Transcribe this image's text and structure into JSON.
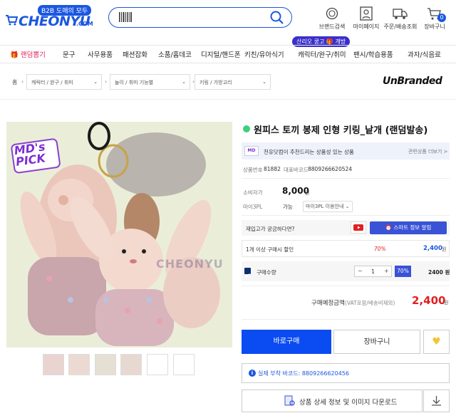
{
  "header": {
    "logo_badge": "B2B 도매의 모두",
    "logo_text": "CHEONYU",
    "logo_com": ".COM",
    "icons": [
      {
        "label": "브랜드검색",
        "icon": "medal-icon"
      },
      {
        "label": "마이페이지",
        "icon": "person-icon"
      },
      {
        "label": "주문/배송조회",
        "icon": "truck-icon"
      },
      {
        "label": "장바구니",
        "icon": "cart-icon"
      }
    ],
    "cart_count": "0"
  },
  "nav": {
    "items": [
      "랜덤뽑기",
      "문구",
      "사무용품",
      "패션잡화",
      "소품/홈데코",
      "디지털/핸드폰",
      "키친/유아식기",
      "캐릭터/완구/취미",
      "팬시/학습용품",
      "과자/식음료"
    ],
    "promo": "산리오 쿵고 🎁 개방",
    "active_color": "#e0245e"
  },
  "breadcrumb": {
    "home": "홈",
    "level1": "캐릭터 / 완구 / 취미",
    "level2": "놀이 / 취미 기능별",
    "level3": "키링 / 가방고리",
    "brand": "UnBranded"
  },
  "image": {
    "badge_line1": "MD's",
    "badge_line2": "PICK",
    "watermark": "CHEONYU"
  },
  "product": {
    "title": "원피스 토끼 봉제 인형 키링_낱개 (랜덤발송)",
    "rec_text": "천유닷컴이 추천드리는 상품성 있는 상품",
    "rec_link": "관련상품 더보기 >",
    "code_label": "상품번호",
    "code": "81882",
    "barcode_label": "대표바코드",
    "barcode": "8809266620524",
    "price_label": "소비자가",
    "price": "8,000",
    "won": "원",
    "mall_label": "마이3PL",
    "mall_value": "가능",
    "mall_guide": "마이3PL 이용안내 ⌄",
    "inquiry": "재입고가 궁금하다면?",
    "smart_alert": "스마트 정보 알림",
    "bulk_label": "1개 이상 구매시 할인",
    "bulk_pct": "70%",
    "bulk_price": "2,400",
    "qty_label": "구매수량",
    "qty": "1",
    "qty_pct": "70%",
    "qty_price": "2400 원",
    "total_label": "구매예정금액",
    "total_note": "(VAT포함/배송비제외)",
    "total": "2,400",
    "buy": "바로구매",
    "cart": "장바구니",
    "real_barcode": "실제 부착 바코드: 8809266620456",
    "download": "상품 상세 정보 및 이미지 다운로드"
  }
}
